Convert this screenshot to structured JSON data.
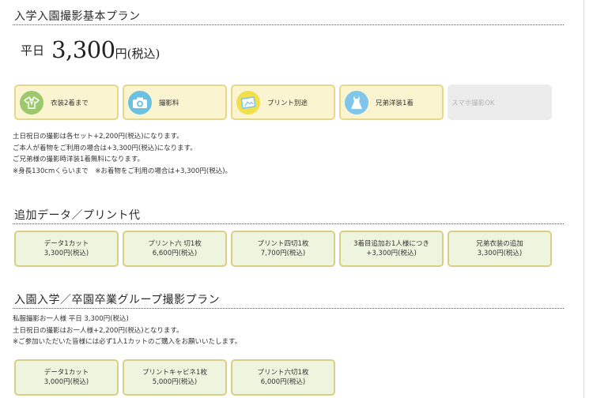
{
  "basic_plan": {
    "title": "入学入園撮影基本プラン",
    "price": {
      "day": "平日",
      "amount": "3,300",
      "unit": "円",
      "tax": "(税込)"
    },
    "features": [
      {
        "label": "衣装2着まで",
        "icon": "kimono-icon",
        "color": "#9cc96b"
      },
      {
        "label": "撮影料",
        "icon": "camera-icon",
        "color": "#6cc1e0"
      },
      {
        "label": "プリント別途",
        "icon": "photo-print-icon",
        "color": "#f1e04a"
      },
      {
        "label": "兄弟洋装1着",
        "icon": "dress-icon",
        "color": "#7fc6ea"
      },
      {
        "label": "スマホ撮影OK",
        "icon": "",
        "color": "#ececec"
      }
    ],
    "notes": [
      "土日祝日の撮影は各セット+2,200円(税込)になります。",
      "ご本人が着物をご利用の場合は+3,300円(税込)になります。",
      "ご兄弟様の撮影時洋装1着無料になります。",
      "※身長130cmくらいまで　※お着物をご利用の場合は+3,300円(税込)。"
    ]
  },
  "additional": {
    "title": "追加データ／プリント代",
    "items": [
      {
        "line1": "データ1カット",
        "line2": "3,300円(税込)"
      },
      {
        "line1": "プリント六 切1枚",
        "line2": "6,600円(税込)"
      },
      {
        "line1": "プリント四切1枚",
        "line2": "7,700円(税込)"
      },
      {
        "line1": "3着目追加お1人様につき",
        "line2": "+3,300円(税込)"
      },
      {
        "line1": "兄弟衣装の追加",
        "line2": "3,300円(税込)"
      }
    ]
  },
  "group_plan": {
    "title": "入園入学／卒園卒業グループ撮影プラン",
    "notes": [
      "私服撮影お一人様 平日 3,300円(税込)",
      "土日祝日の撮影はお一人様+2,200円(税込)となります。",
      "※ご参加いただいた皆様には必ず1人1カットのご購入をお願いいたします。"
    ],
    "items": [
      {
        "line1": "データ1カット",
        "line2": "3,000円(税込)"
      },
      {
        "line1": "プリントキャビネ1枚",
        "line2": "5,000円(税込)"
      },
      {
        "line1": "プリント六切1枚",
        "line2": "6,000円(税込)"
      }
    ]
  }
}
